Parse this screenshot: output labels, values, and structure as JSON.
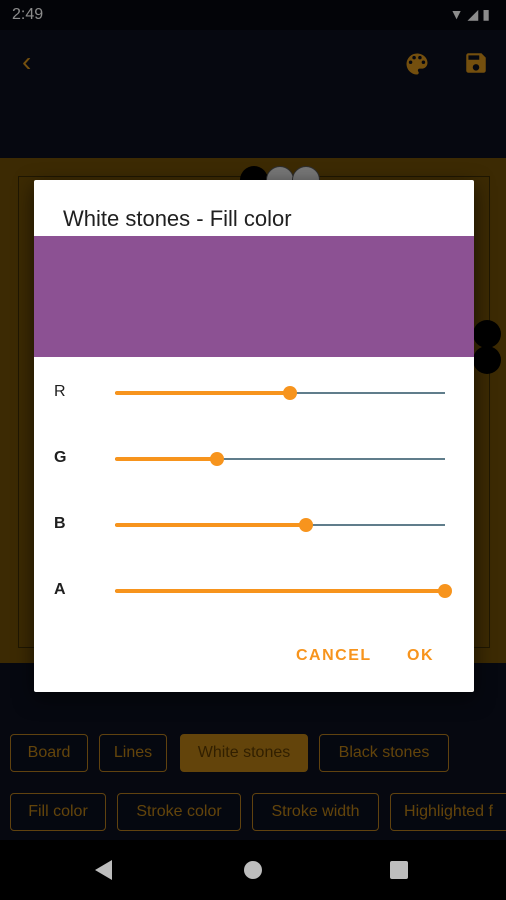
{
  "status_bar": {
    "time": "2:49"
  },
  "dialog": {
    "title": "White stones - Fill color",
    "preview_color": "#8c5193",
    "sliders": [
      {
        "label": "R",
        "value": 0.53
      },
      {
        "label": "G",
        "value": 0.31
      },
      {
        "label": "B",
        "value": 0.58
      },
      {
        "label": "A",
        "value": 1.0
      }
    ],
    "cancel_label": "CANCEL",
    "ok_label": "OK"
  },
  "category_tabs": [
    "Board",
    "Lines",
    "White stones",
    "Black stones"
  ],
  "property_tabs": [
    "Fill color",
    "Stroke color",
    "Stroke width",
    "Highlighted f"
  ],
  "colors": {
    "accent": "#f7941d",
    "board": "#b57d14",
    "background": "#0b0f1e"
  }
}
